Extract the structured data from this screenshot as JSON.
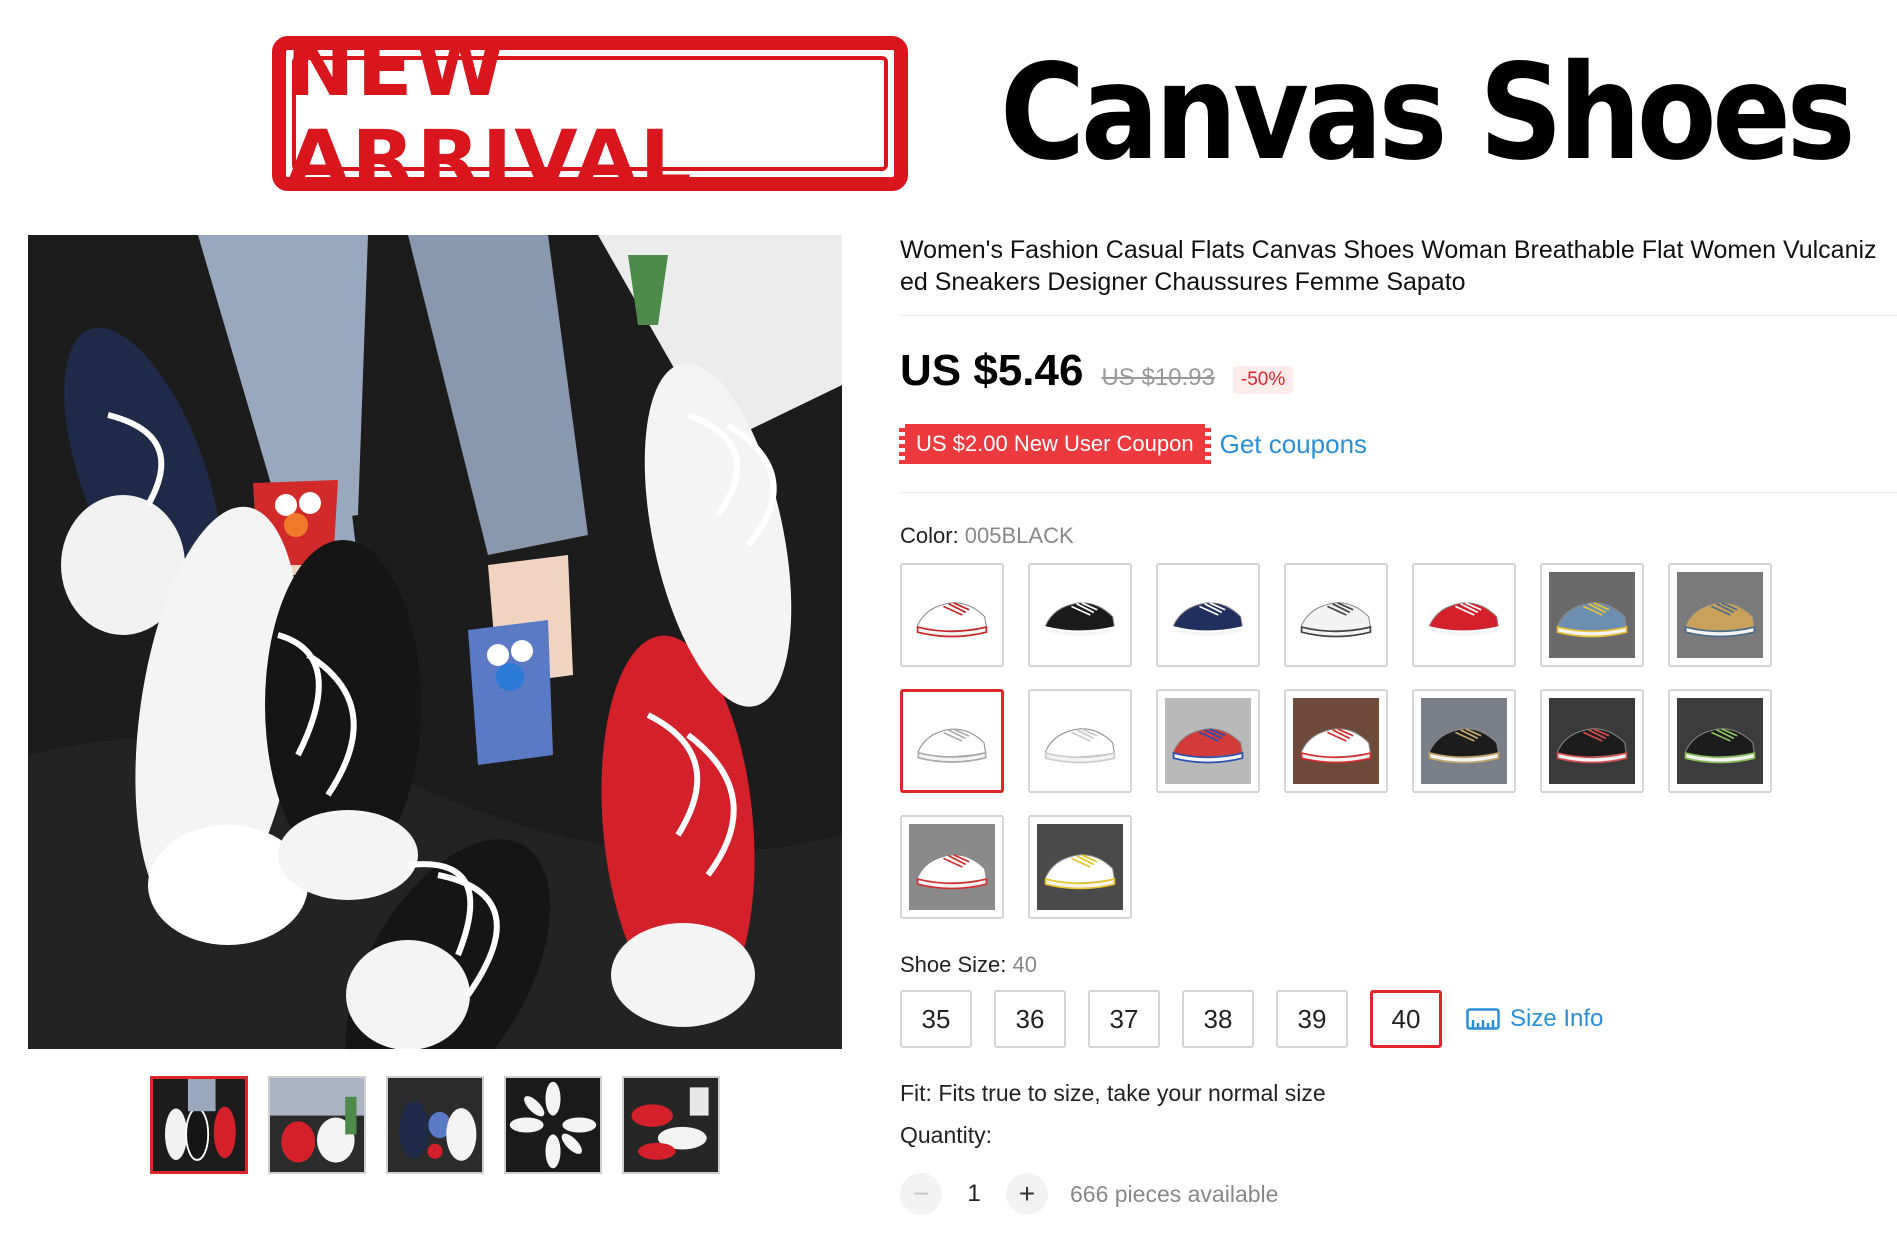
{
  "banner": {
    "stamp_text": "NEW ARRIVAL",
    "headline": "Canvas Shoes"
  },
  "product": {
    "title": "Women's Fashion Casual Flats Canvas Shoes Woman Breathable Flat Women Vulcanized Sneakers Designer Chaussures Femme Sapato",
    "price": "US $5.46",
    "old_price": "US $10.93",
    "discount": "-50%"
  },
  "coupon": {
    "label": "US $2.00 New User Coupon",
    "link": "Get coupons"
  },
  "color": {
    "label": "Color: ",
    "value": "005BLACK",
    "swatches": [
      {
        "shoe": "#ffffff",
        "accent": "#c62828",
        "bg": "#ffffff"
      },
      {
        "shoe": "#1a1a1a",
        "accent": "#ffffff",
        "bg": "#ffffff"
      },
      {
        "shoe": "#1f2f5e",
        "accent": "#ffffff",
        "bg": "#ffffff"
      },
      {
        "shoe": "#f3f3f3",
        "accent": "#444444",
        "bg": "#ffffff"
      },
      {
        "shoe": "#d3202a",
        "accent": "#ffffff",
        "bg": "#ffffff"
      },
      {
        "shoe": "#6c8fb0",
        "accent": "#e8c03a",
        "bg": "#6a6a6a"
      },
      {
        "shoe": "#c9a15a",
        "accent": "#4a6b8a",
        "bg": "#7a7a7a"
      },
      {
        "shoe": "#ffffff",
        "accent": "#aaaaaa",
        "bg": "#ffffff"
      },
      {
        "shoe": "#ffffff",
        "accent": "#cccccc",
        "bg": "#ffffff"
      },
      {
        "shoe": "#d33a3a",
        "accent": "#2a4fae",
        "bg": "#b9b9b9"
      },
      {
        "shoe": "#ffffff",
        "accent": "#d23030",
        "bg": "#6e4a3a"
      },
      {
        "shoe": "#1c1c1c",
        "accent": "#c2a56a",
        "bg": "#7a7f88"
      },
      {
        "shoe": "#1c1c1c",
        "accent": "#d05050",
        "bg": "#3a3a3a"
      },
      {
        "shoe": "#1c1c1c",
        "accent": "#8bbf5a",
        "bg": "#3c3c3c"
      },
      {
        "shoe": "#ffffff",
        "accent": "#d23030",
        "bg": "#8a8a8a"
      },
      {
        "shoe": "#ffffff",
        "accent": "#e7c62a",
        "bg": "#4a4a4a"
      }
    ]
  },
  "size": {
    "label": "Shoe Size: ",
    "value": "40",
    "options": [
      "35",
      "36",
      "37",
      "38",
      "39",
      "40"
    ],
    "info_link": "Size Info"
  },
  "fit": "Fit: Fits true to size, take your normal size",
  "quantity": {
    "label": "Quantity:",
    "minus": "−",
    "plus": "+",
    "value": "1",
    "available": "666 pieces available"
  }
}
